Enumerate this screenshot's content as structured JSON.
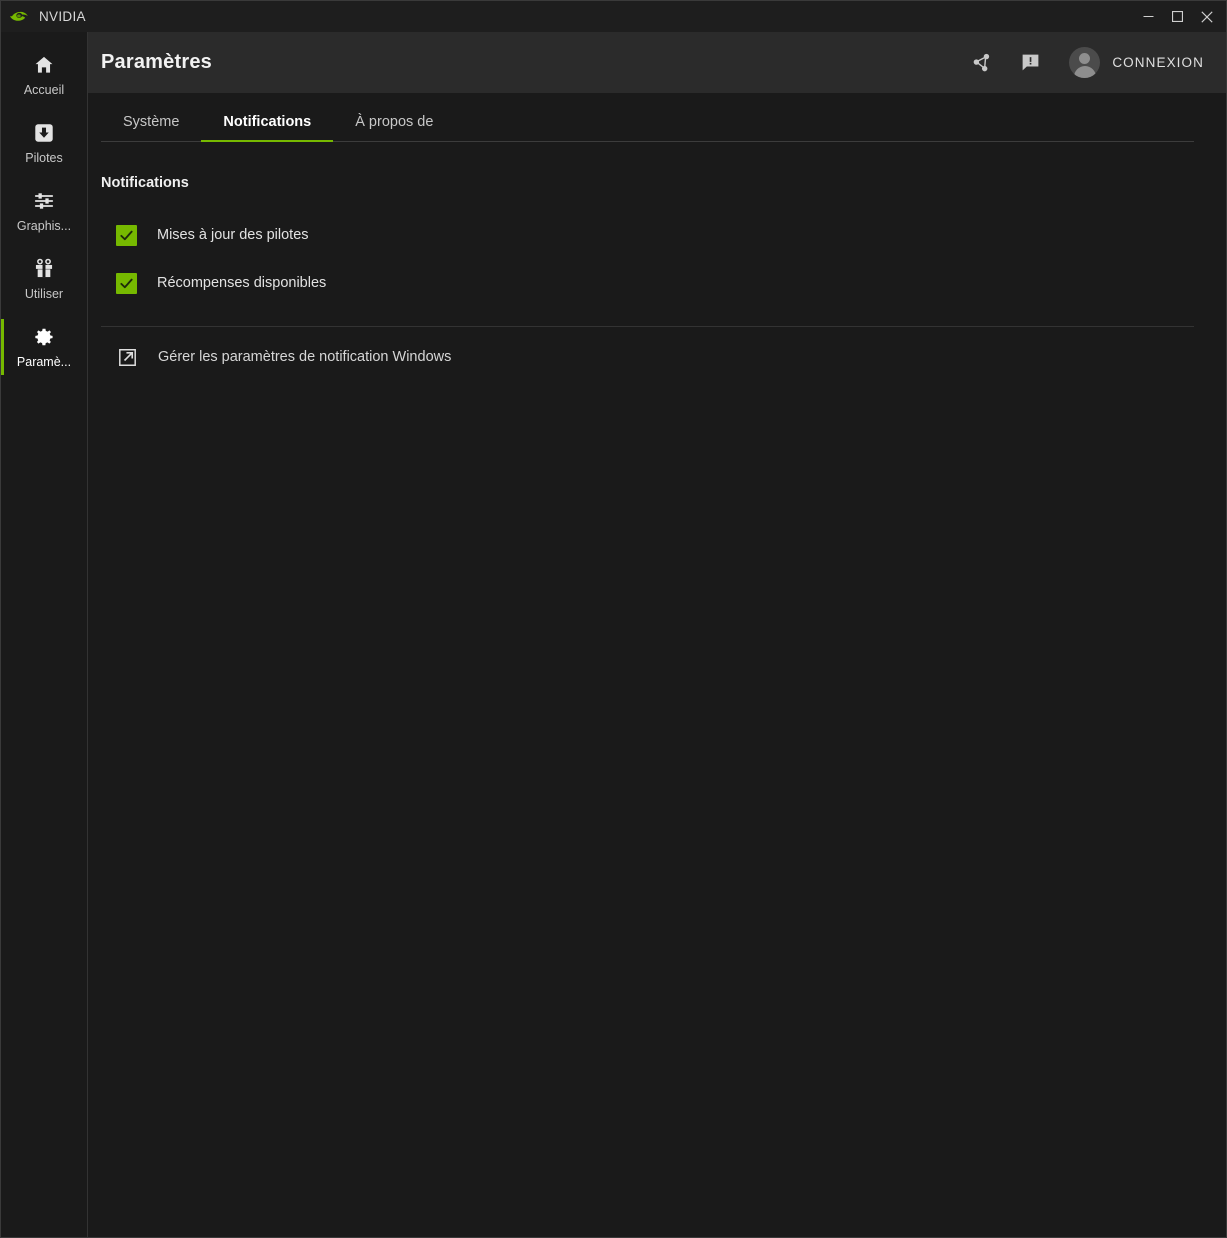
{
  "window": {
    "app_title": "NVIDIA",
    "logo_icon": "nvidia-eye-logo",
    "controls": {
      "minimize": "minimize-icon",
      "maximize": "maximize-icon",
      "close": "close-icon"
    }
  },
  "sidebar": {
    "items": [
      {
        "label": "Accueil",
        "icon": "home-icon",
        "active": false
      },
      {
        "label": "Pilotes",
        "icon": "download-icon",
        "active": false
      },
      {
        "label": "Graphis...",
        "icon": "sliders-icon",
        "active": false
      },
      {
        "label": "Utiliser",
        "icon": "gift-icon",
        "active": false
      },
      {
        "label": "Paramè...",
        "icon": "gear-icon",
        "active": true
      }
    ]
  },
  "header": {
    "title": "Paramètres",
    "actions": [
      {
        "name": "share-icon",
        "label": "share-icon"
      },
      {
        "name": "feedback-icon",
        "label": "feedback-icon"
      }
    ],
    "login_label": "CONNEXION",
    "avatar_icon": "avatar-icon"
  },
  "tabs": [
    {
      "label": "Système",
      "active": false
    },
    {
      "label": "Notifications",
      "active": true
    },
    {
      "label": "À propos de",
      "active": false
    }
  ],
  "content": {
    "section_title": "Notifications",
    "options": [
      {
        "label": "Mises à jour des pilotes",
        "checked": true
      },
      {
        "label": "Récompenses disponibles",
        "checked": true
      }
    ],
    "link": {
      "label": "Gérer les paramètres de notification Windows",
      "icon": "external-link-icon"
    }
  },
  "colors": {
    "accent_green": "#76b900",
    "window_bg": "#1a1a1a",
    "header_bg": "#2b2b2b",
    "titlebar_bg": "#1e1e1e"
  }
}
